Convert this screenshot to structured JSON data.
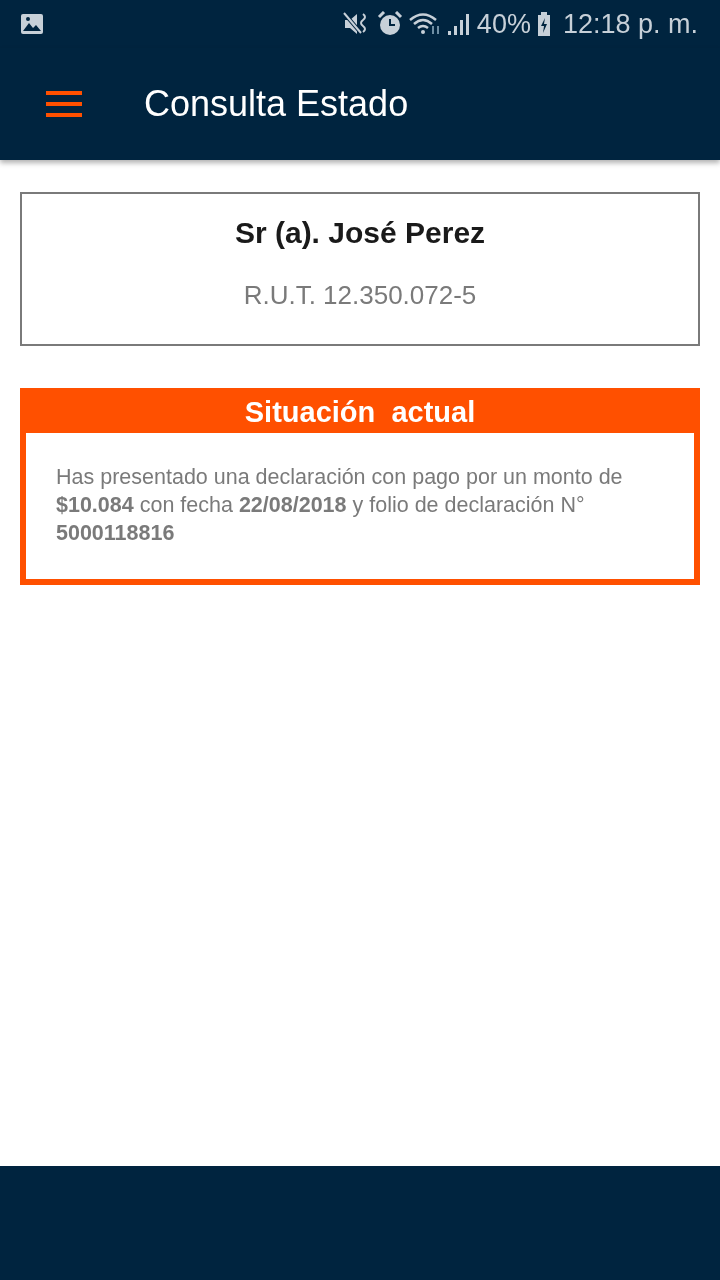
{
  "status_bar": {
    "battery": "40%",
    "time": "12:18 p. m."
  },
  "app_bar": {
    "title": "Consulta Estado"
  },
  "person": {
    "name": "Sr (a). José Perez",
    "rut": "R.U.T. 12.350.072-5"
  },
  "situation": {
    "title": "Situación  actual",
    "text": "Has presentado una declaración con pago por un monto de **$10.084** con fecha **22/08/2018** y folio de declaración N° **5000118816**"
  }
}
